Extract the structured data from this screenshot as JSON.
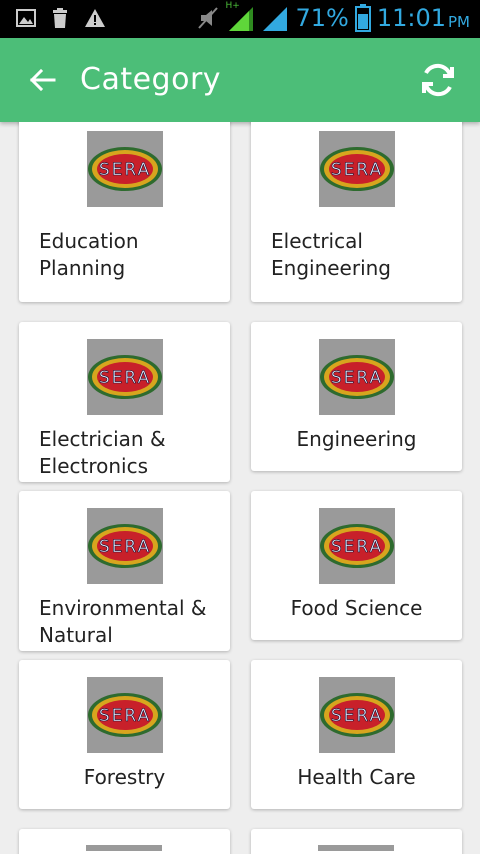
{
  "status_bar": {
    "battery_percent": "71%",
    "time": "11:01",
    "ampm": "PM",
    "network": "H+"
  },
  "app_bar": {
    "title": "Category"
  },
  "categories": [
    {
      "label": "Education Planning",
      "logo_text": "SERA"
    },
    {
      "label": "Electrical Engineering",
      "logo_text": "SERA"
    },
    {
      "label": "Electrician & Electronics",
      "logo_text": "SERA"
    },
    {
      "label": "Engineering",
      "logo_text": "SERA"
    },
    {
      "label": "Environmental & Natural",
      "logo_text": "SERA"
    },
    {
      "label": "Food Science",
      "logo_text": "SERA"
    },
    {
      "label": "Forestry",
      "logo_text": "SERA"
    },
    {
      "label": "Health Care",
      "logo_text": "SERA"
    }
  ],
  "colors": {
    "accent": "#4cbe78",
    "status_blue": "#32a9e0",
    "background": "#eeeeee"
  },
  "icons": {
    "back": "arrow-left-icon",
    "refresh": "refresh-icon"
  }
}
